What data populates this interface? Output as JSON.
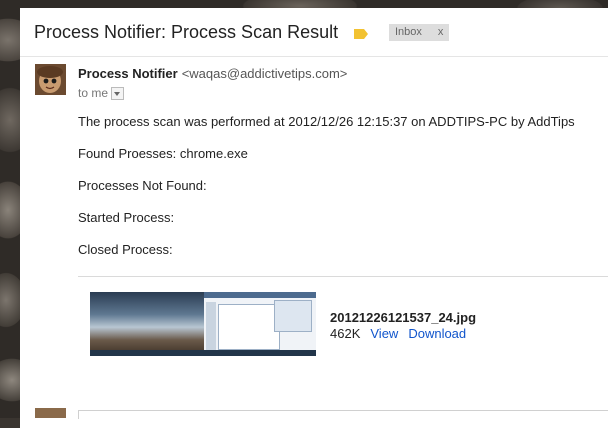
{
  "email": {
    "subject": "Process Notifier: Process Scan Result",
    "label_chip": "Inbox",
    "label_close": "x",
    "label_tag_color": "#f2c232",
    "sender_name": "Process Notifier",
    "sender_email": "<waqas@addictivetips.com>",
    "recipient": "to me",
    "body": [
      "The process scan was performed at 2012/12/26 12:15:37 on ADDTIPS-PC by AddTips",
      "Found Proesses: chrome.exe",
      "Processes Not Found:",
      "Started Process:",
      "Closed Process:"
    ]
  },
  "attachment": {
    "filename": "20121226121537_24.jpg",
    "size": "462K",
    "view_label": "View",
    "download_label": "Download",
    "link_color": "#1155cc"
  }
}
